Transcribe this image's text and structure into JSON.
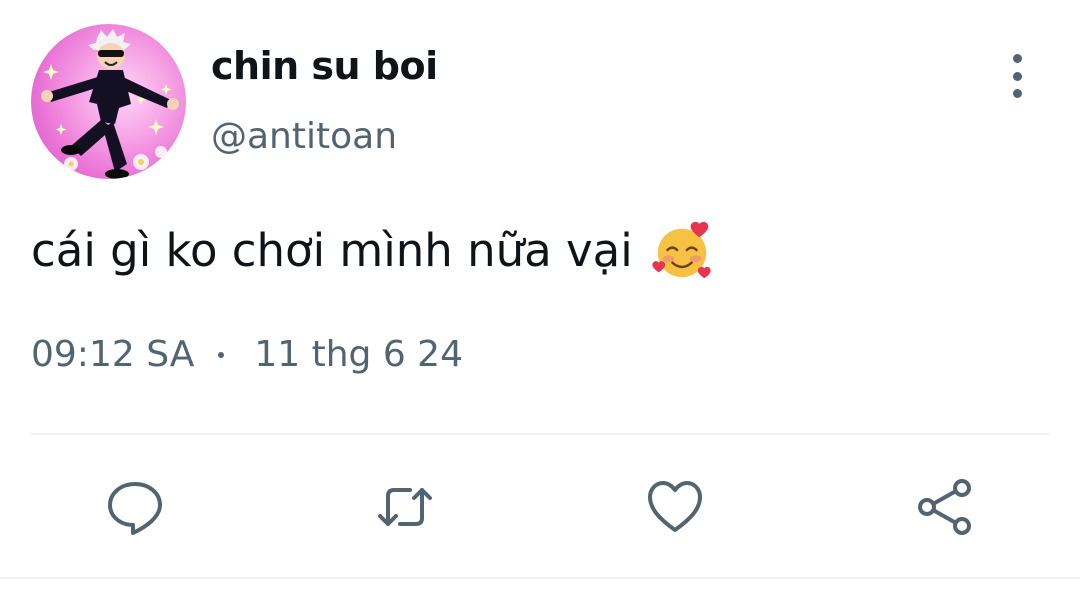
{
  "tweet": {
    "display_name": "chin su boi",
    "handle": "@antitoan",
    "text": "cái gì ko chơi mình nữa vại",
    "emoji": "smiling-face-with-hearts",
    "time": "09:12 SA",
    "date": "11 thg 6 24"
  },
  "icons": {
    "more": "more-vertical-icon",
    "reply": "reply-icon",
    "retweet": "retweet-icon",
    "like": "heart-icon",
    "share": "share-icon"
  },
  "colors": {
    "text": "#0f1419",
    "secondary": "#536471",
    "divider": "#eff3f4",
    "background": "#ffffff"
  }
}
